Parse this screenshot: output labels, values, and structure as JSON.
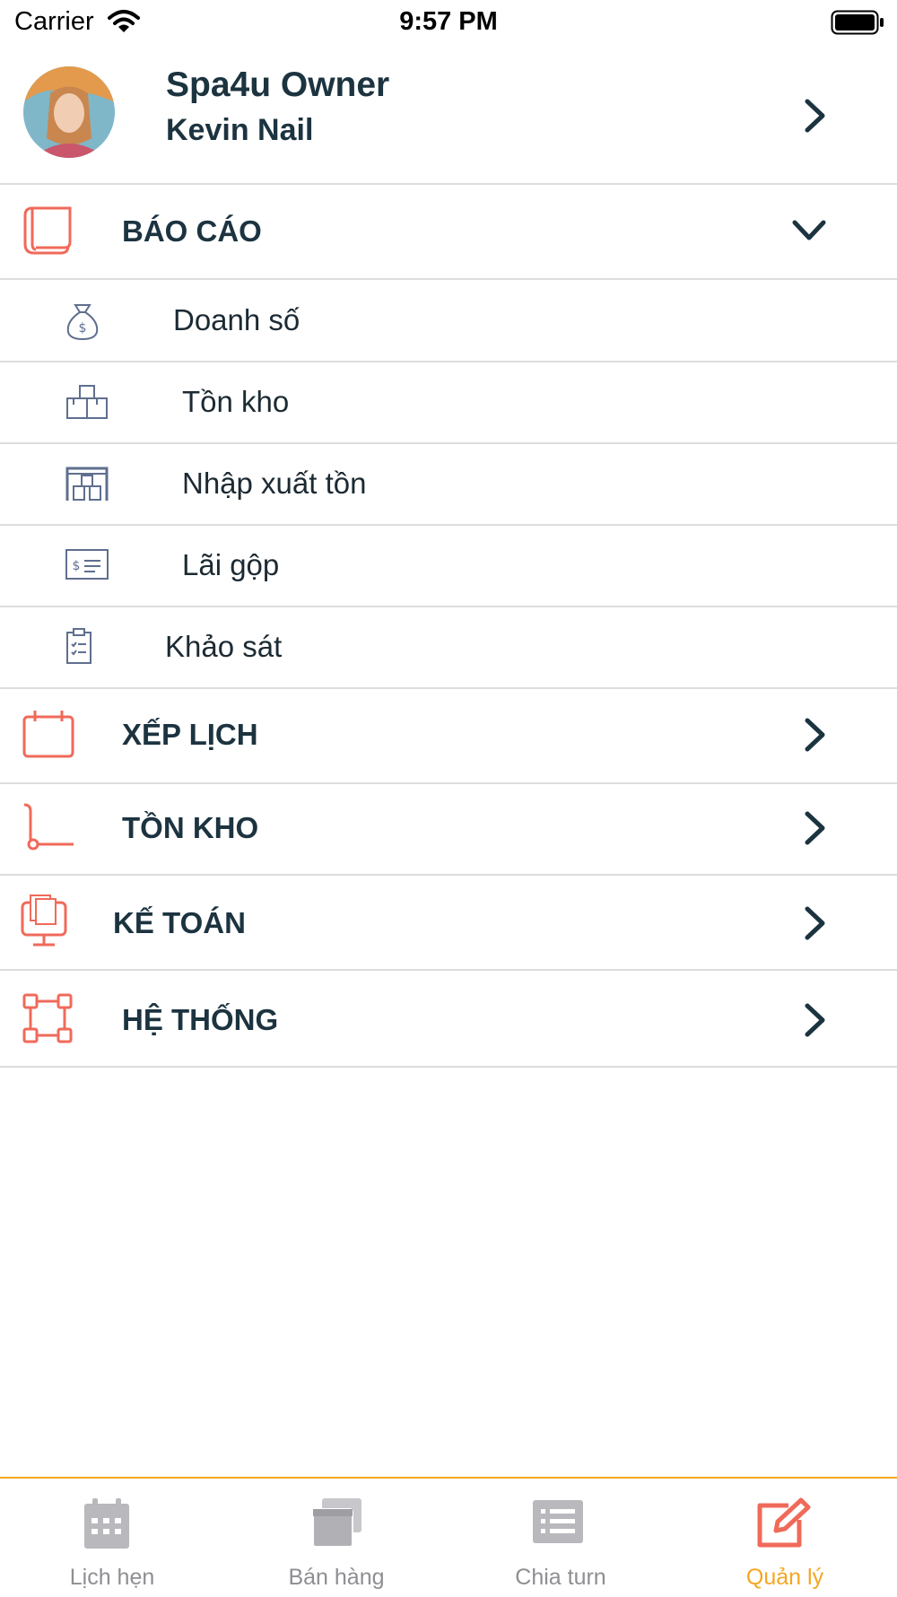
{
  "status_bar": {
    "carrier": "Carrier",
    "time": "9:57 PM"
  },
  "profile": {
    "role": "Spa4u Owner",
    "shop": "Kevin Nail"
  },
  "sections": [
    {
      "label": "BÁO CÁO",
      "icon": "report-icon",
      "expanded": true
    },
    {
      "label": "XẾP LỊCH",
      "icon": "calendar-icon",
      "expanded": false
    },
    {
      "label": "TỒN KHO",
      "icon": "hand-truck-icon",
      "expanded": false
    },
    {
      "label": "KẾ TOÁN",
      "icon": "accounting-icon",
      "expanded": false
    },
    {
      "label": "HỆ THỐNG",
      "icon": "system-icon",
      "expanded": false
    }
  ],
  "report_items": [
    {
      "label": "Doanh số",
      "icon": "money-bag-icon"
    },
    {
      "label": "Tồn kho",
      "icon": "boxes-icon"
    },
    {
      "label": "Nhập xuất tồn",
      "icon": "warehouse-icon"
    },
    {
      "label": "Lãi gộp",
      "icon": "dollar-card-icon"
    },
    {
      "label": "Khảo sát",
      "icon": "clipboard-icon"
    }
  ],
  "tabs": [
    {
      "label": "Lịch hẹn",
      "icon": "calendar-grid-icon",
      "active": false
    },
    {
      "label": "Bán hàng",
      "icon": "stacked-windows-icon",
      "active": false
    },
    {
      "label": "Chia turn",
      "icon": "list-icon",
      "active": false
    },
    {
      "label": "Quản lý",
      "icon": "edit-icon",
      "active": true
    }
  ],
  "colors": {
    "accent": "#f5a623",
    "icon_red": "#f06a5a",
    "text_dark": "#1c3340",
    "tab_gray": "#8e8e93"
  }
}
